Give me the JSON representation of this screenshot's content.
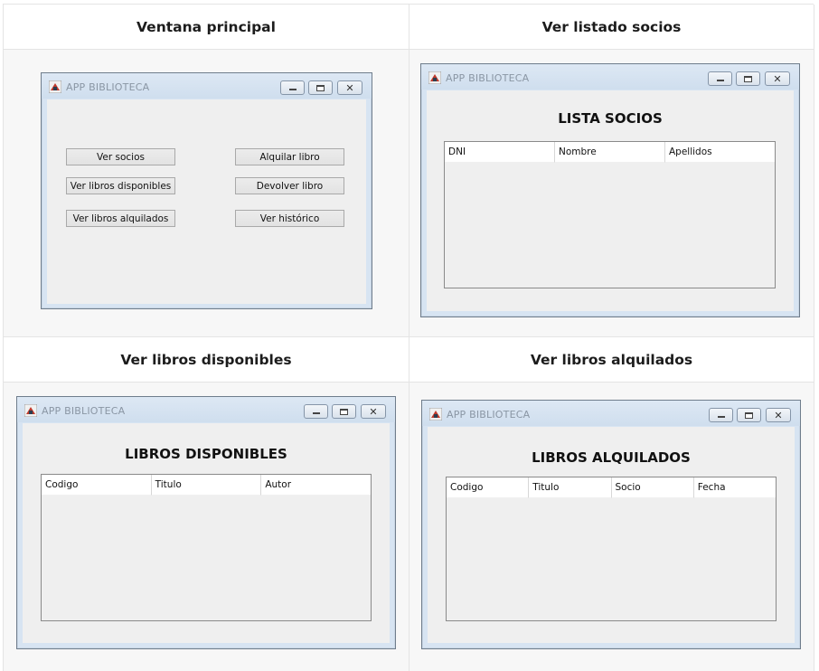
{
  "headers": {
    "main_window": "Ventana principal",
    "members_list": "Ver listado socios",
    "available_books": "Ver libros disponibles",
    "rented_books": "Ver libros alquilados"
  },
  "window": {
    "title": "APP BIBLIOTECA",
    "min_symbol": "",
    "max_symbol": "",
    "close_symbol": "✕"
  },
  "main_window": {
    "buttons_left": [
      "Ver socios",
      "Ver libros disponibles",
      "Ver libros alquilados"
    ],
    "buttons_right": [
      "Alquilar libro",
      "Devolver libro",
      "Ver histórico"
    ]
  },
  "members_window": {
    "heading": "LISTA SOCIOS",
    "columns": [
      "DNI",
      "Nombre",
      "Apellidos"
    ]
  },
  "available_window": {
    "heading": "LIBROS DISPONIBLES",
    "columns": [
      "Codigo",
      "Titulo",
      "Autor"
    ]
  },
  "rented_window": {
    "heading": "LIBROS ALQUILADOS",
    "columns": [
      "Codigo",
      "Titulo",
      "Socio",
      "Fecha"
    ]
  },
  "colors": {
    "window_frame": "#d7e4f2",
    "client_area": "#efefef",
    "title_text": "#8a96a4"
  },
  "icons": [
    "app-icon",
    "minimize-icon",
    "maximize-icon",
    "close-icon"
  ]
}
